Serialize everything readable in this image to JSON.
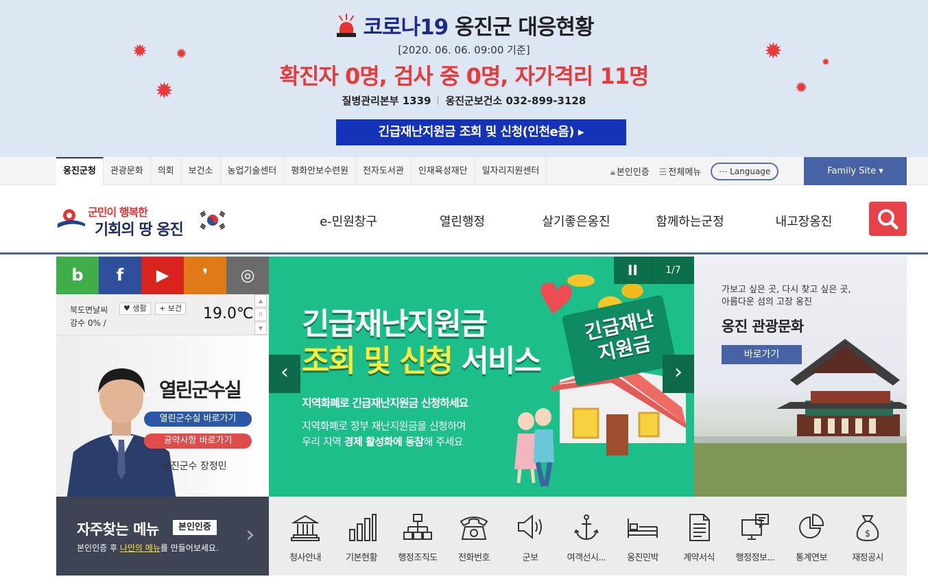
{
  "covid": {
    "title_part1": "코로나19",
    "title_part2": " 옹진군 대응현황",
    "date": "[2020. 06. 06. 09:00 기준]",
    "stats": "확진자 0명, 검사 중 0명, 자가격리 11명",
    "phone1": "질병관리본부 1339",
    "phone2": "옹진군보건소 032-899-3128",
    "button": "긴급재난지원금 조회 및 신청(인천e음) ▸",
    "accent": "#e83a3a"
  },
  "topbar": {
    "tabs": [
      "옹진군청",
      "관광문화",
      "의회",
      "보건소",
      "농업기술센터",
      "평화안보수련원",
      "전자도서관",
      "인재육성재단",
      "일자리지원센터"
    ],
    "cert": "본인인증",
    "all_menu": "전체메뉴",
    "language": "⋯ Language",
    "family_site": "Family Site  ▾"
  },
  "header": {
    "logo_line1": "군민이 행복한",
    "logo_line2": "기회의 땅 옹진",
    "nav": [
      "e-민원창구",
      "열린행정",
      "살기좋은옹진",
      "함께하는군정",
      "내고장옹진"
    ],
    "brand_color": "#4862a6"
  },
  "sns": [
    {
      "icon": "blog-icon",
      "glyph": "b",
      "color": "#3fae49"
    },
    {
      "icon": "facebook-icon",
      "glyph": "f",
      "color": "#2f4e9b"
    },
    {
      "icon": "youtube-icon",
      "glyph": "▶",
      "color": "#d9231d"
    },
    {
      "icon": "kakaostory-icon",
      "glyph": "❜",
      "color": "#e07a18"
    },
    {
      "icon": "instagram-icon",
      "glyph": "◎",
      "color": "#6b6b6b"
    }
  ],
  "weather": {
    "location": "북도면날씨",
    "chip_life": "♥ 생활",
    "chip_health": "+ 보건",
    "rain": "강수 0% /",
    "temp": "19.0℃"
  },
  "mayor": {
    "title": "열린군수실",
    "btn_open": "열린군수실 바로가기",
    "btn_pledge": "공약사항 바로가기",
    "name": "옹진군수 장정민"
  },
  "slider": {
    "headline1": "긴급재난지원금",
    "headline2_yellow": "조회 및 신청",
    "headline2_white": " 서비스",
    "card": "긴급재난 지원금",
    "sub": "지역화폐로 긴급재난지원금 신청하세요",
    "body_line1": "지역화폐로 정부 재난지원금을 신청하여",
    "body_line2_pre": "우리 지역 ",
    "body_line2_bold": "경제 활성화에 동참",
    "body_line2_post": "해 주세요",
    "pause": "II",
    "count": "1/7",
    "prev": "‹",
    "next": "›"
  },
  "tour": {
    "intro1": "가보고 싶은 곳, 다시 찾고 싶은 곳,",
    "intro2": "아름다운 섬의 고장 옹진",
    "title": "옹진 관광문화",
    "button": "바로가기"
  },
  "quick": {
    "title": "자주찾는 메뉴",
    "badge": "본인인증",
    "desc_pre": "본인인증 후 ",
    "desc_hl": "나만의 메뉴",
    "desc_post": "를 만들어보세요.",
    "arrow": "›",
    "items": [
      {
        "label": "청사안내",
        "icon": "building-icon"
      },
      {
        "label": "기본현황",
        "icon": "bar-chart-icon"
      },
      {
        "label": "행정조직도",
        "icon": "org-chart-icon"
      },
      {
        "label": "전화번호",
        "icon": "telephone-icon"
      },
      {
        "label": "군보",
        "icon": "speaker-icon"
      },
      {
        "label": "여객선시...",
        "icon": "anchor-icon"
      },
      {
        "label": "옹진민박",
        "icon": "bed-icon"
      },
      {
        "label": "계약서식",
        "icon": "document-icon"
      },
      {
        "label": "행정정보...",
        "icon": "monitor-icon"
      },
      {
        "label": "통계연보",
        "icon": "pie-chart-icon"
      },
      {
        "label": "재정공시",
        "icon": "money-bag-icon"
      }
    ]
  }
}
